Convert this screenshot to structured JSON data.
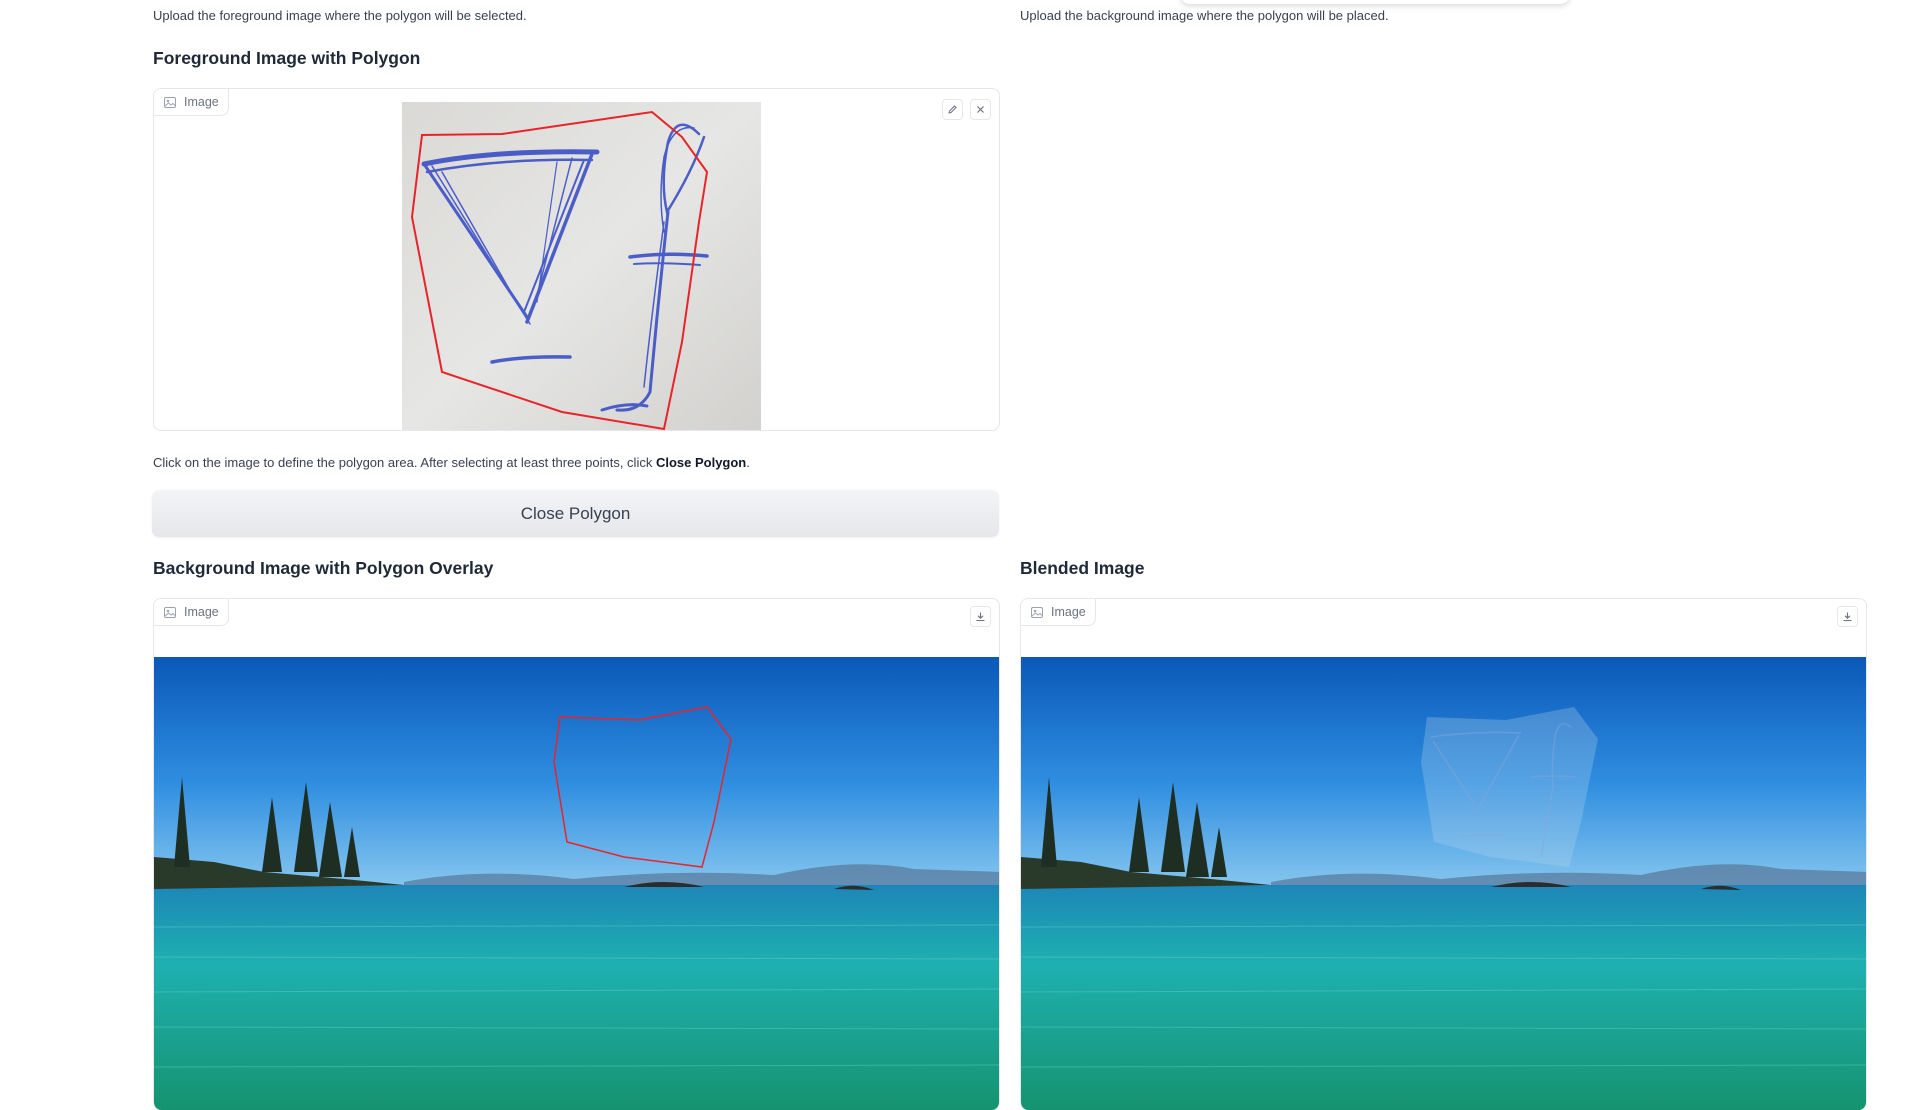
{
  "left_column": {
    "upload_description": "Upload the foreground image where the polygon will be selected.",
    "foreground_title": "Foreground Image with Polygon",
    "foreground_badge": "Image",
    "instruction_prefix": "Click on the image to define the polygon area. After selecting at least three points, click ",
    "instruction_bold": "Close Polygon",
    "instruction_suffix": ".",
    "close_polygon_button": "Close Polygon",
    "overlay_title": "Background Image with Polygon Overlay",
    "overlay_badge": "Image"
  },
  "right_column": {
    "upload_description": "Upload the background image where the polygon will be placed.",
    "blended_title": "Blended Image",
    "blended_badge": "Image"
  },
  "icons": {
    "badge": "image-icon",
    "edit": "pencil-icon",
    "clear": "close-icon",
    "download": "download-icon"
  },
  "colors": {
    "polygon_stroke": "#e8242a",
    "ink_stroke": "#3147c4",
    "sky_top": "#0a58b8",
    "water": "#1eb0b0"
  }
}
